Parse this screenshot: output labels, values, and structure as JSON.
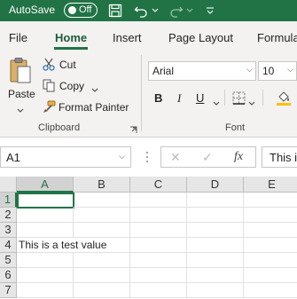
{
  "titlebar": {
    "autosave_label": "AutoSave",
    "autosave_state": "Off",
    "bg_color": "#217346",
    "icons": [
      "save-icon",
      "undo-icon",
      "redo-icon",
      "customize-qat-icon"
    ]
  },
  "tabs": [
    {
      "label": "File",
      "active": false
    },
    {
      "label": "Home",
      "active": true
    },
    {
      "label": "Insert",
      "active": false
    },
    {
      "label": "Page Layout",
      "active": false
    },
    {
      "label": "Formula",
      "active": false
    }
  ],
  "ribbon": {
    "clipboard": {
      "paste": "Paste",
      "cut": "Cut",
      "copy": "Copy",
      "format_painter": "Format Painter",
      "label": "Clipboard"
    },
    "font": {
      "font_name": "Arial",
      "font_size": "10",
      "bold": "B",
      "italic": "I",
      "underline": "U",
      "label": "Font"
    }
  },
  "formula_bar": {
    "name_box": "A1",
    "cancel": "✕",
    "enter": "✓",
    "fx": "fx",
    "content": "This i"
  },
  "sheet": {
    "columns": [
      "A",
      "B",
      "C",
      "D",
      "E"
    ],
    "rows": [
      "1",
      "2",
      "3",
      "4",
      "5",
      "6",
      "7"
    ],
    "cells": {
      "A4": "This is a test value"
    }
  }
}
